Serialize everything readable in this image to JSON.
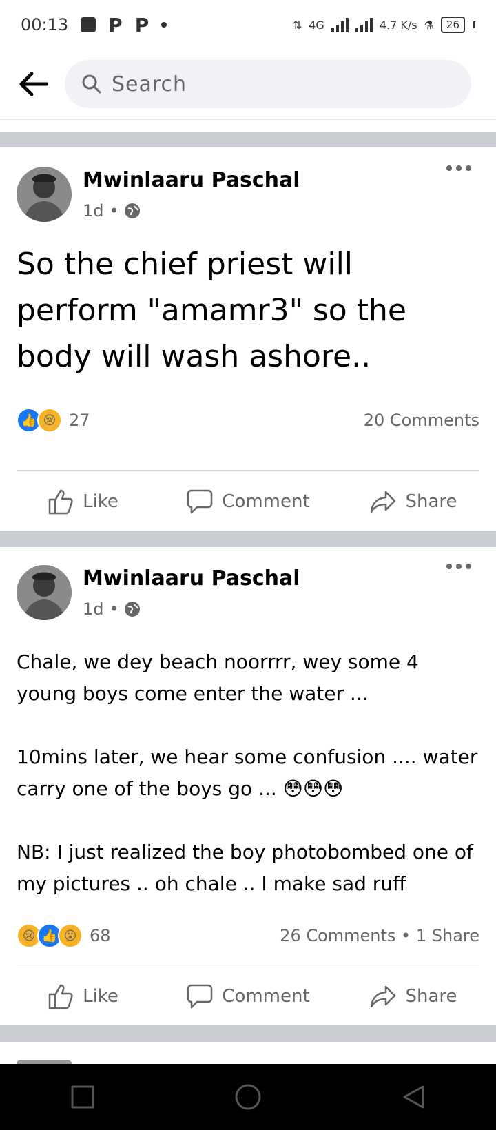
{
  "status_bar": {
    "time": "00:13",
    "p1": "P",
    "p2": "P",
    "network": "4G",
    "speed": "4.7 K/s",
    "battery": "26"
  },
  "search": {
    "placeholder": "Search"
  },
  "posts": [
    {
      "author": "Mwinlaaru Paschal",
      "time": "1d",
      "text": "So the chief priest will perform \"amamr3\" so the body will wash ashore..",
      "reaction_count": "27",
      "counts": "20 Comments"
    },
    {
      "author": "Mwinlaaru Paschal",
      "time": "1d",
      "text": "Chale, we dey beach noorrrr, wey some 4 young boys come enter the water ...\n\n10mins later, we hear some confusion .... water carry one of the boys go ... 😳😳😳\n\nNB: I just realized the boy photobombed one of my pictures .. oh chale .. I make sad ruff",
      "reaction_count": "68",
      "counts": "26 Comments • 1 Share"
    }
  ],
  "actions": {
    "like": "Like",
    "comment": "Comment",
    "share": "Share"
  }
}
